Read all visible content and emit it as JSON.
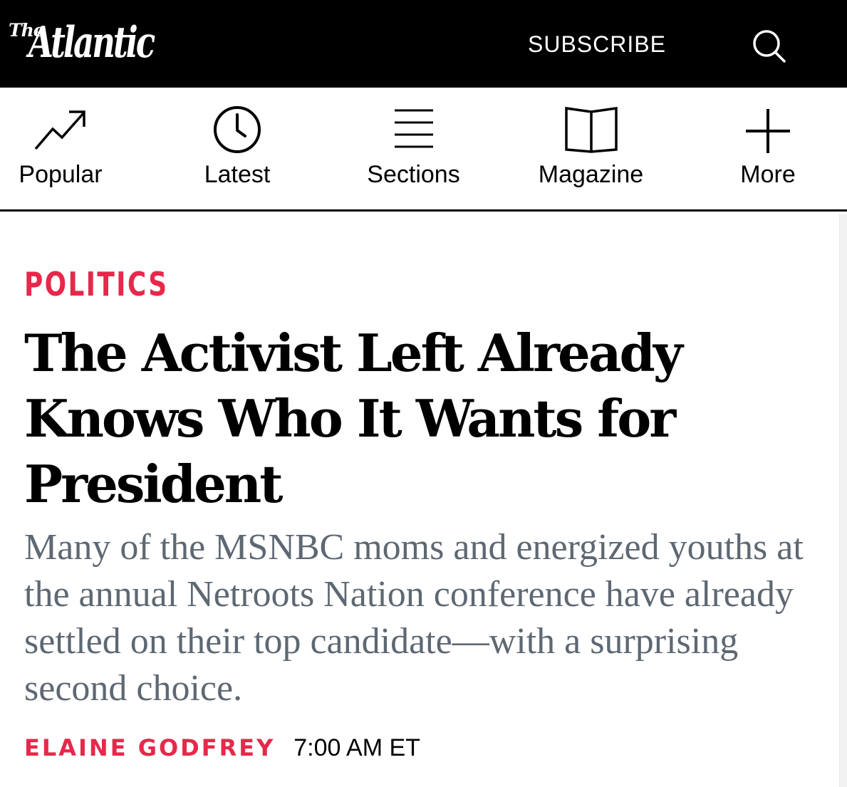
{
  "header": {
    "logo_the": "The",
    "logo_name": "Atlantic",
    "subscribe_label": "SUBSCRIBE",
    "search_icon": "search-icon",
    "background": "#000000"
  },
  "nav": {
    "items": [
      {
        "label": "Popular",
        "icon": "trending-up-icon"
      },
      {
        "label": "Latest",
        "icon": "clock-icon"
      },
      {
        "label": "Sections",
        "icon": "menu-lines-icon"
      },
      {
        "label": "Magazine",
        "icon": "open-book-icon"
      },
      {
        "label": "More",
        "icon": "plus-icon"
      }
    ]
  },
  "article": {
    "section": "POLITICS",
    "headline": "The Activist Left Already Knows Who It Wants for President",
    "dek": "Many of the MSNBC moms and energized youths at the annual Netroots Nation conference have already settled on their top candidate—with a surprising second choice.",
    "author": "ELAINE GODFREY",
    "time": "7:00 AM ET"
  },
  "colors": {
    "accent": "#e7284a",
    "dek": "#5e6873",
    "text": "#000000"
  }
}
